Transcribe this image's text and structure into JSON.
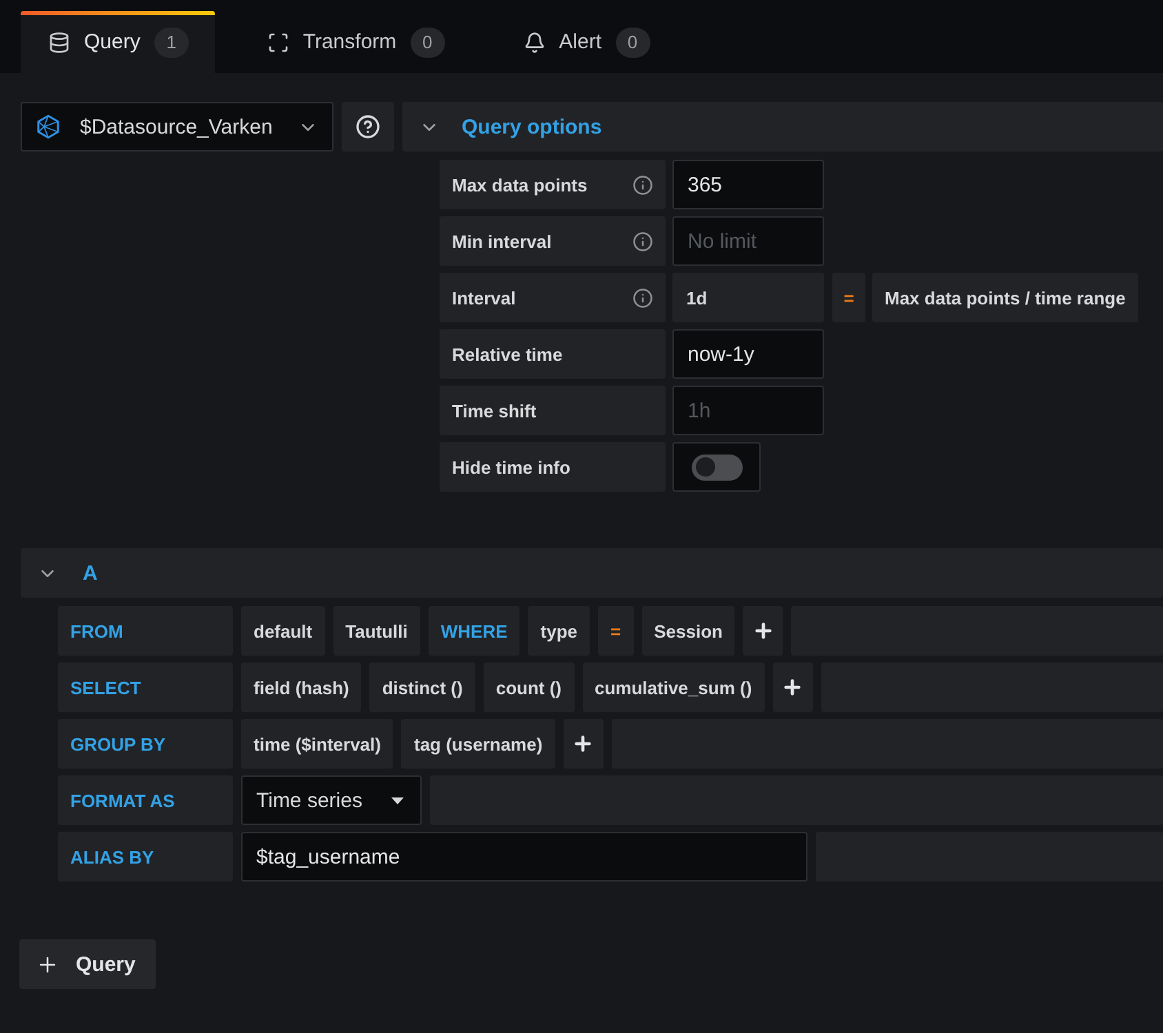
{
  "tabs": [
    {
      "label": "Query",
      "count": "1",
      "kind": "query",
      "selected": true
    },
    {
      "label": "Transform",
      "count": "0",
      "kind": "transform",
      "selected": false
    },
    {
      "label": "Alert",
      "count": "0",
      "kind": "alert",
      "selected": false
    }
  ],
  "datasource": {
    "value": "$Datasource_Varken"
  },
  "query_options": {
    "title": "Query options",
    "expanded": true,
    "rows": [
      {
        "label": "Max data points",
        "info": true,
        "kind": "input",
        "value": "365"
      },
      {
        "label": "Min interval",
        "info": true,
        "kind": "input",
        "placeholder": "No limit"
      },
      {
        "label": "Interval",
        "info": true,
        "kind": "computed",
        "value": "1d",
        "operator": "=",
        "note": "Max data points / time range"
      },
      {
        "label": "Relative time",
        "info": false,
        "kind": "input",
        "value": "now-1y"
      },
      {
        "label": "Time shift",
        "info": false,
        "kind": "input",
        "placeholder": "1h"
      },
      {
        "label": "Hide time info",
        "info": false,
        "kind": "switch",
        "on": false
      }
    ]
  },
  "query": {
    "name": "A",
    "expanded": true,
    "rows": [
      {
        "keyword": "FROM",
        "segments": [
          {
            "kind": "value",
            "text": "default"
          },
          {
            "kind": "value",
            "text": "Tautulli"
          },
          {
            "kind": "keyword",
            "text": "WHERE"
          },
          {
            "kind": "value",
            "text": "type"
          },
          {
            "kind": "operator",
            "text": "="
          },
          {
            "kind": "value",
            "text": "Session"
          },
          {
            "kind": "add"
          }
        ]
      },
      {
        "keyword": "SELECT",
        "segments": [
          {
            "kind": "value",
            "text": "field (hash)"
          },
          {
            "kind": "value",
            "text": "distinct ()"
          },
          {
            "kind": "value",
            "text": "count ()"
          },
          {
            "kind": "value",
            "text": "cumulative_sum ()"
          },
          {
            "kind": "add"
          }
        ]
      },
      {
        "keyword": "GROUP BY",
        "segments": [
          {
            "kind": "value",
            "text": "time ($interval)"
          },
          {
            "kind": "value",
            "text": "tag (username)"
          },
          {
            "kind": "add"
          }
        ]
      },
      {
        "keyword": "FORMAT AS",
        "segments": [
          {
            "kind": "select",
            "text": "Time series"
          }
        ]
      },
      {
        "keyword": "ALIAS BY",
        "segments": [
          {
            "kind": "input",
            "text": "$tag_username"
          }
        ]
      }
    ]
  },
  "add_query_button": {
    "label": "Query"
  }
}
